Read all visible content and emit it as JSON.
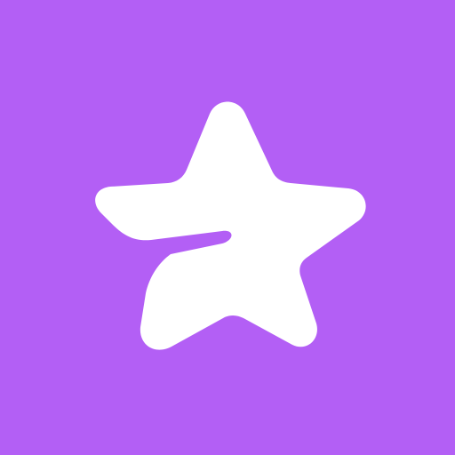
{
  "icon": {
    "name": "premium-star-icon",
    "background_color": "#B35FF5",
    "glyph_color": "#FFFFFF"
  }
}
